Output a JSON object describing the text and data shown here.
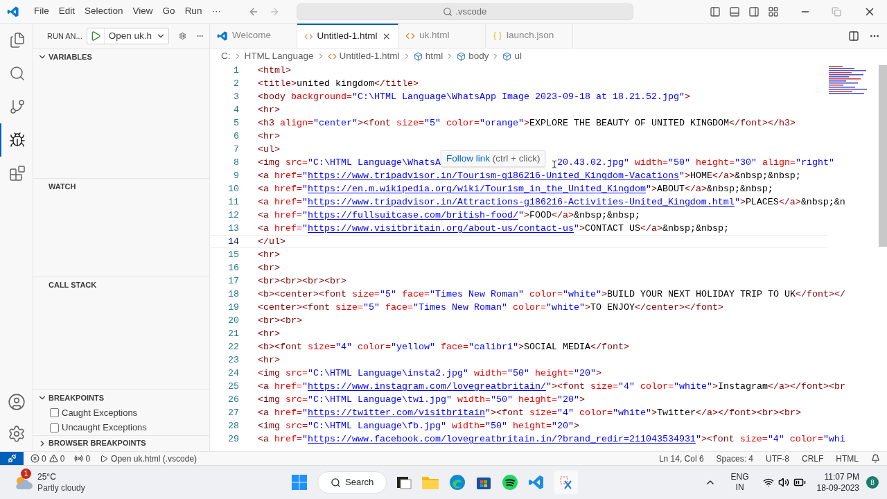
{
  "menu": [
    "File",
    "Edit",
    "Selection",
    "View",
    "Go",
    "Run",
    "···"
  ],
  "command_center": {
    "title": ".vscode"
  },
  "activity_bar": [
    {
      "kind": "files",
      "selected": false
    },
    {
      "kind": "search",
      "selected": false
    },
    {
      "kind": "git",
      "selected": false
    },
    {
      "kind": "debug",
      "selected": true
    },
    {
      "kind": "extensions",
      "selected": false
    }
  ],
  "sidebar": {
    "title": "RUN AN...",
    "launch_config": "Open uk.h",
    "sections": [
      {
        "title": "VARIABLES",
        "expanded": true
      },
      {
        "title": "WATCH"
      },
      {
        "title": "CALL STACK"
      },
      {
        "title": "BREAKPOINTS",
        "expanded": true,
        "items": [
          {
            "label": "Caught Exceptions",
            "checked": false
          },
          {
            "label": "Uncaught Exceptions",
            "checked": false
          }
        ]
      },
      {
        "title": "BROWSER BREAKPOINTS",
        "expanded": false
      }
    ]
  },
  "tabs": [
    {
      "label": "Welcome",
      "kind": "welcome",
      "selected": false
    },
    {
      "label": "Untitled-1.html",
      "kind": "html",
      "selected": true
    },
    {
      "label": "uk.html",
      "kind": "html",
      "selected": false
    },
    {
      "label": "launch.json",
      "kind": "json",
      "selected": false
    }
  ],
  "breadcrumbs": [
    {
      "label": "C:",
      "kind": "folder"
    },
    {
      "label": "HTML Language",
      "kind": "folder"
    },
    {
      "label": "Untitled-1.html",
      "kind": "file"
    },
    {
      "label": "html",
      "kind": "element"
    },
    {
      "label": "body",
      "kind": "element"
    },
    {
      "label": "ul",
      "kind": "element"
    }
  ],
  "editor": {
    "lines": [
      {
        "n": "1",
        "current": false,
        "t": [
          {
            "kind": "tag",
            "text": "<html>"
          }
        ]
      },
      {
        "n": "2",
        "current": false,
        "t": [
          {
            "kind": "tag",
            "text": "<title>"
          },
          {
            "kind": "text",
            "text": "united kingdom"
          },
          {
            "kind": "tag",
            "text": "</title>"
          }
        ]
      },
      {
        "n": "3",
        "current": false,
        "t": [
          {
            "kind": "tag",
            "text": "<body"
          },
          {
            "kind": "attr",
            "text": " background="
          },
          {
            "kind": "string",
            "text": "\"C:\\HTML Language\\WhatsApp Image 2023-09-18 at 18.21.52.jpg\""
          },
          {
            "kind": "tag",
            "text": ">"
          }
        ]
      },
      {
        "n": "4",
        "current": false,
        "t": [
          {
            "kind": "tag",
            "text": "<hr>"
          }
        ]
      },
      {
        "n": "5",
        "current": false,
        "t": [
          {
            "kind": "tag",
            "text": "<h3"
          },
          {
            "kind": "attr",
            "text": " align="
          },
          {
            "kind": "string",
            "text": "\"center\""
          },
          {
            "kind": "tag",
            "text": "><font"
          },
          {
            "kind": "attr",
            "text": " size="
          },
          {
            "kind": "string",
            "text": "\"5\""
          },
          {
            "kind": "attr",
            "text": " color="
          },
          {
            "kind": "string",
            "text": "\"orange\""
          },
          {
            "kind": "tag",
            "text": ">"
          },
          {
            "kind": "text",
            "text": "EXPLORE THE BEAUTY OF UNITED KINGDOM"
          },
          {
            "kind": "tag",
            "text": "</font></h3>"
          }
        ]
      },
      {
        "n": "6",
        "current": false,
        "t": [
          {
            "kind": "tag",
            "text": "<hr>"
          }
        ]
      },
      {
        "n": "7",
        "current": false,
        "t": [
          {
            "kind": "tag",
            "text": "<ul>"
          }
        ]
      },
      {
        "n": "8",
        "current": false,
        "t": [
          {
            "kind": "tag",
            "text": "<img"
          },
          {
            "kind": "attr",
            "text": " src="
          },
          {
            "kind": "string",
            "text": "\"C:\\HTML Language\\WhatsA"
          },
          {
            "kind": "tooltip",
            "link": "Follow link",
            "hint": "(ctrl + click)"
          },
          {
            "kind": "string",
            "text": "20.43.02.jpg\""
          },
          {
            "kind": "attr",
            "text": " width="
          },
          {
            "kind": "string",
            "text": "\"50\""
          },
          {
            "kind": "attr",
            "text": " height="
          },
          {
            "kind": "string",
            "text": "\"30\""
          },
          {
            "kind": "attr",
            "text": " align="
          },
          {
            "kind": "string",
            "text": "\"right\""
          }
        ]
      },
      {
        "n": "9",
        "current": false,
        "t": [
          {
            "kind": "tag",
            "text": "<a"
          },
          {
            "kind": "attr",
            "text": " href="
          },
          {
            "kind": "string",
            "text": "\""
          },
          {
            "kind": "link",
            "text": "https://www.tripadvisor.in/Tourism-g186216-United_Kingdom-Vacations"
          },
          {
            "kind": "string",
            "text": "\""
          },
          {
            "kind": "tag",
            "text": ">"
          },
          {
            "kind": "text",
            "text": "HOME"
          },
          {
            "kind": "tag",
            "text": "</a>"
          },
          {
            "kind": "text",
            "text": "&nbsp;&nbsp;"
          }
        ]
      },
      {
        "n": "10",
        "current": false,
        "t": [
          {
            "kind": "tag",
            "text": "<a"
          },
          {
            "kind": "attr",
            "text": " href="
          },
          {
            "kind": "string",
            "text": "\""
          },
          {
            "kind": "link",
            "text": "https://en.m.wikipedia.org/wiki/Tourism_in_the_United_Kingdom"
          },
          {
            "kind": "string",
            "text": "\""
          },
          {
            "kind": "tag",
            "text": ">"
          },
          {
            "kind": "text",
            "text": "ABOUT"
          },
          {
            "kind": "tag",
            "text": "</a>"
          },
          {
            "kind": "text",
            "text": "&nbsp;&nbsp;"
          }
        ]
      },
      {
        "n": "11",
        "current": false,
        "t": [
          {
            "kind": "tag",
            "text": "<a"
          },
          {
            "kind": "attr",
            "text": " href="
          },
          {
            "kind": "string",
            "text": "\""
          },
          {
            "kind": "link",
            "text": "https://www.tripadvisor.in/Attractions-g186216-Activities-United_Kingdom.html"
          },
          {
            "kind": "string",
            "text": "\""
          },
          {
            "kind": "tag",
            "text": ">"
          },
          {
            "kind": "text",
            "text": "PLACES"
          },
          {
            "kind": "tag",
            "text": "</a>"
          },
          {
            "kind": "text",
            "text": "&nbsp;&n"
          }
        ]
      },
      {
        "n": "12",
        "current": false,
        "t": [
          {
            "kind": "tag",
            "text": "<a"
          },
          {
            "kind": "attr",
            "text": " href="
          },
          {
            "kind": "string",
            "text": "\""
          },
          {
            "kind": "link",
            "text": "https://fullsuitcase.com/british-food/"
          },
          {
            "kind": "string",
            "text": "\""
          },
          {
            "kind": "tag",
            "text": ">"
          },
          {
            "kind": "text",
            "text": "FOOD"
          },
          {
            "kind": "tag",
            "text": "</a>"
          },
          {
            "kind": "text",
            "text": "&nbsp;&nbsp;"
          }
        ]
      },
      {
        "n": "13",
        "current": false,
        "t": [
          {
            "kind": "tag",
            "text": "<a"
          },
          {
            "kind": "attr",
            "text": " href="
          },
          {
            "kind": "string",
            "text": "\""
          },
          {
            "kind": "link",
            "text": "https://www.visitbritain.org/about-us/contact-us"
          },
          {
            "kind": "string",
            "text": "\""
          },
          {
            "kind": "tag",
            "text": ">"
          },
          {
            "kind": "text",
            "text": "CONTACT US"
          },
          {
            "kind": "tag",
            "text": "</a>"
          },
          {
            "kind": "text",
            "text": "&nbsp;&nbsp;"
          }
        ]
      },
      {
        "n": "14",
        "current": true,
        "t": [
          {
            "kind": "tag",
            "text": "</ul>"
          }
        ]
      },
      {
        "n": "15",
        "current": false,
        "t": [
          {
            "kind": "tag",
            "text": "<hr>"
          }
        ]
      },
      {
        "n": "16",
        "current": false,
        "t": [
          {
            "kind": "tag",
            "text": "<br>"
          }
        ]
      },
      {
        "n": "17",
        "current": false,
        "t": [
          {
            "kind": "tag",
            "text": "<br><br><br><br>"
          }
        ]
      },
      {
        "n": "18",
        "current": false,
        "t": [
          {
            "kind": "tag",
            "text": "<b><center><font"
          },
          {
            "kind": "attr",
            "text": " size="
          },
          {
            "kind": "string",
            "text": "\"5\""
          },
          {
            "kind": "attr",
            "text": " face="
          },
          {
            "kind": "string",
            "text": "\"Times New Roman\""
          },
          {
            "kind": "attr",
            "text": " color="
          },
          {
            "kind": "string",
            "text": "\"white\""
          },
          {
            "kind": "tag",
            "text": ">"
          },
          {
            "kind": "text",
            "text": "BUILD YOUR NEXT HOLIDAY TRIP TO UK"
          },
          {
            "kind": "tag",
            "text": "</font></"
          }
        ]
      },
      {
        "n": "19",
        "current": false,
        "t": [
          {
            "kind": "tag",
            "text": "<center><font"
          },
          {
            "kind": "attr",
            "text": " size="
          },
          {
            "kind": "string",
            "text": "\"5\""
          },
          {
            "kind": "attr",
            "text": " face="
          },
          {
            "kind": "string",
            "text": "\"Times New Roman\""
          },
          {
            "kind": "attr",
            "text": " color="
          },
          {
            "kind": "string",
            "text": "\"white\""
          },
          {
            "kind": "tag",
            "text": ">"
          },
          {
            "kind": "text",
            "text": "TO ENJOY"
          },
          {
            "kind": "tag",
            "text": "</center></font>"
          }
        ]
      },
      {
        "n": "20",
        "current": false,
        "t": [
          {
            "kind": "tag",
            "text": "<br><br>"
          }
        ]
      },
      {
        "n": "21",
        "current": false,
        "t": [
          {
            "kind": "tag",
            "text": "<hr>"
          }
        ]
      },
      {
        "n": "22",
        "current": false,
        "t": [
          {
            "kind": "tag",
            "text": "<b><font"
          },
          {
            "kind": "attr",
            "text": " size="
          },
          {
            "kind": "string",
            "text": "\"4\""
          },
          {
            "kind": "attr",
            "text": " color="
          },
          {
            "kind": "string",
            "text": "\"yellow\""
          },
          {
            "kind": "attr",
            "text": " face="
          },
          {
            "kind": "string",
            "text": "\"calibri\""
          },
          {
            "kind": "tag",
            "text": ">"
          },
          {
            "kind": "text",
            "text": "SOCIAL MEDIA"
          },
          {
            "kind": "tag",
            "text": "</font>"
          }
        ]
      },
      {
        "n": "23",
        "current": false,
        "t": [
          {
            "kind": "tag",
            "text": "<hr>"
          }
        ]
      },
      {
        "n": "24",
        "current": false,
        "t": [
          {
            "kind": "tag",
            "text": "<img"
          },
          {
            "kind": "attr",
            "text": " src="
          },
          {
            "kind": "string",
            "text": "\"C:\\HTML Language\\insta2.jpg\""
          },
          {
            "kind": "attr",
            "text": " width="
          },
          {
            "kind": "string",
            "text": "\"50\""
          },
          {
            "kind": "attr",
            "text": " height="
          },
          {
            "kind": "string",
            "text": "\"20\""
          },
          {
            "kind": "tag",
            "text": ">"
          }
        ]
      },
      {
        "n": "25",
        "current": false,
        "t": [
          {
            "kind": "tag",
            "text": "<a"
          },
          {
            "kind": "attr",
            "text": " href="
          },
          {
            "kind": "string",
            "text": "\""
          },
          {
            "kind": "link",
            "text": "https://www.instagram.com/lovegreatbritain/"
          },
          {
            "kind": "string",
            "text": "\""
          },
          {
            "kind": "tag",
            "text": "><font"
          },
          {
            "kind": "attr",
            "text": " size="
          },
          {
            "kind": "string",
            "text": "\"4\""
          },
          {
            "kind": "attr",
            "text": " color="
          },
          {
            "kind": "string",
            "text": "\"white\""
          },
          {
            "kind": "tag",
            "text": ">"
          },
          {
            "kind": "text",
            "text": "Instagram"
          },
          {
            "kind": "tag",
            "text": "</a></font><br"
          }
        ]
      },
      {
        "n": "26",
        "current": false,
        "t": [
          {
            "kind": "tag",
            "text": "<img"
          },
          {
            "kind": "attr",
            "text": " src="
          },
          {
            "kind": "string",
            "text": "\"C:\\HTML Language\\twi.jpg\""
          },
          {
            "kind": "attr",
            "text": " width="
          },
          {
            "kind": "string",
            "text": "\"50\""
          },
          {
            "kind": "attr",
            "text": " height="
          },
          {
            "kind": "string",
            "text": "\"20\""
          },
          {
            "kind": "tag",
            "text": ">"
          }
        ]
      },
      {
        "n": "27",
        "current": false,
        "t": [
          {
            "kind": "tag",
            "text": "<a"
          },
          {
            "kind": "attr",
            "text": " href="
          },
          {
            "kind": "string",
            "text": "\""
          },
          {
            "kind": "link",
            "text": "https://twitter.com/visitbritain"
          },
          {
            "kind": "string",
            "text": "\""
          },
          {
            "kind": "tag",
            "text": "><font"
          },
          {
            "kind": "attr",
            "text": " size="
          },
          {
            "kind": "string",
            "text": "\"4\""
          },
          {
            "kind": "attr",
            "text": " color="
          },
          {
            "kind": "string",
            "text": "\"white\""
          },
          {
            "kind": "tag",
            "text": ">"
          },
          {
            "kind": "text",
            "text": "Twitter"
          },
          {
            "kind": "tag",
            "text": "</a></font><br><br>"
          }
        ]
      },
      {
        "n": "28",
        "current": false,
        "t": [
          {
            "kind": "tag",
            "text": "<img"
          },
          {
            "kind": "attr",
            "text": " src="
          },
          {
            "kind": "string",
            "text": "\"C:\\HTML Language\\fb.jpg\""
          },
          {
            "kind": "attr",
            "text": " width="
          },
          {
            "kind": "string",
            "text": "\"50\""
          },
          {
            "kind": "attr",
            "text": " height="
          },
          {
            "kind": "string",
            "text": "\"20\""
          },
          {
            "kind": "tag",
            "text": ">"
          }
        ]
      },
      {
        "n": "29",
        "current": false,
        "t": [
          {
            "kind": "tag",
            "text": "<a"
          },
          {
            "kind": "attr",
            "text": " href="
          },
          {
            "kind": "string",
            "text": "\""
          },
          {
            "kind": "link",
            "text": "https://www.facebook.com/lovegreatbritain.in/?brand_redir=211043534931"
          },
          {
            "kind": "string",
            "text": "\""
          },
          {
            "kind": "tag",
            "text": "><font"
          },
          {
            "kind": "attr",
            "text": " size="
          },
          {
            "kind": "string",
            "text": "\"4\""
          },
          {
            "kind": "attr",
            "text": " color="
          },
          {
            "kind": "string",
            "text": "\"whi"
          }
        ]
      }
    ]
  },
  "status_bar": {
    "errors": "0",
    "warnings": "0",
    "ports": "0",
    "task": "Open uk.html (.vscode)",
    "items": [
      "Ln 14, Col 6",
      "Spaces: 4",
      "UTF-8",
      "CRLF",
      "HTML"
    ]
  },
  "taskbar": {
    "temperature": "25°C",
    "condition": "Partly cloudy",
    "weather_badge": "1",
    "search": "Search",
    "apps": [
      {
        "kind": "start"
      },
      {
        "kind": "taskview"
      },
      {
        "kind": "folder"
      },
      {
        "kind": "browser"
      },
      {
        "kind": "store"
      },
      {
        "kind": "music"
      },
      {
        "kind": "editor"
      },
      {
        "kind": "snip"
      }
    ],
    "language": "ENG",
    "region": "IN",
    "time": "11:07 PM",
    "date": "18-09-2023",
    "notifications": "8"
  }
}
